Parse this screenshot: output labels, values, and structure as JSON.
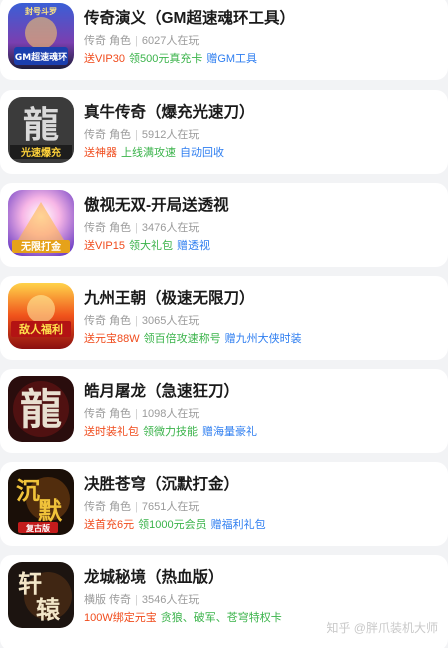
{
  "games": [
    {
      "title": "传奇演义（GM超速魂环工具）",
      "meta": [
        "传奇",
        "角色",
        "6027人在玩"
      ],
      "tags": [
        {
          "text": "送VIP30",
          "color": "red"
        },
        {
          "text": "领500元真充卡",
          "color": "green"
        },
        {
          "text": "赠GM工具",
          "color": "blue"
        }
      ],
      "icon": "legend-game-icon",
      "icon_text": [
        "封号斗罗",
        "GM超速魂环"
      ]
    },
    {
      "title": "真牛传奇（爆充光速刀）",
      "meta": [
        "传奇",
        "角色",
        "5912人在玩"
      ],
      "tags": [
        {
          "text": "送神器",
          "color": "red"
        },
        {
          "text": "上线满攻速",
          "color": "green"
        },
        {
          "text": "自动回收",
          "color": "blue"
        }
      ],
      "icon": "dragon-character-icon",
      "icon_text": [
        "龍",
        "光速爆充"
      ]
    },
    {
      "title": "傲视无双-开局送透视",
      "meta": [
        "传奇",
        "角色",
        "3476人在玩"
      ],
      "tags": [
        {
          "text": "送VIP15",
          "color": "red"
        },
        {
          "text": "领大礼包",
          "color": "green"
        },
        {
          "text": "赠透视",
          "color": "blue"
        }
      ],
      "icon": "warrior-icon",
      "icon_text": [
        "无限打金"
      ]
    },
    {
      "title": "九州王朝（极速无限刀）",
      "meta": [
        "传奇",
        "角色",
        "3065人在玩"
      ],
      "tags": [
        {
          "text": "送元宝88W",
          "color": "red"
        },
        {
          "text": "领百倍攻速称号",
          "color": "green"
        },
        {
          "text": "赠九州大侠时装",
          "color": "blue"
        }
      ],
      "icon": "flame-icon",
      "icon_text": [
        "敌人福利"
      ]
    },
    {
      "title": "皓月屠龙（急速狂刀）",
      "meta": [
        "传奇",
        "角色",
        "1098人在玩"
      ],
      "tags": [
        {
          "text": "送时装礼包",
          "color": "red"
        },
        {
          "text": "领微力技能",
          "color": "green"
        },
        {
          "text": "赠海量豪礼",
          "color": "blue"
        }
      ],
      "icon": "dragon-character-icon",
      "icon_text": [
        "龍"
      ]
    },
    {
      "title": "决胜苍穹（沉默打金）",
      "meta": [
        "传奇",
        "角色",
        "7651人在玩"
      ],
      "tags": [
        {
          "text": "送首充6元",
          "color": "red"
        },
        {
          "text": "领1000元会员",
          "color": "green"
        },
        {
          "text": "赠福利礼包",
          "color": "blue"
        }
      ],
      "icon": "silence-character-icon",
      "icon_text": [
        "沉",
        "默",
        "复古版"
      ]
    },
    {
      "title": "龙城秘境（热血版）",
      "meta": [
        "横版",
        "传奇",
        "3546人在玩"
      ],
      "tags": [
        {
          "text": "100W绑定元宝",
          "color": "red"
        },
        {
          "text": "贪狼、破军、苍穹特权卡",
          "color": "green"
        }
      ],
      "icon": "xuanyuan-character-icon",
      "icon_text": [
        "轩",
        "辕"
      ]
    }
  ],
  "watermark": "知乎 @胖爪装机大师",
  "colors": {
    "red": "#f04b1c",
    "green": "#3ab34a",
    "blue": "#2e7ef0",
    "title": "#1a1a1a",
    "meta": "#9a9a9a"
  }
}
